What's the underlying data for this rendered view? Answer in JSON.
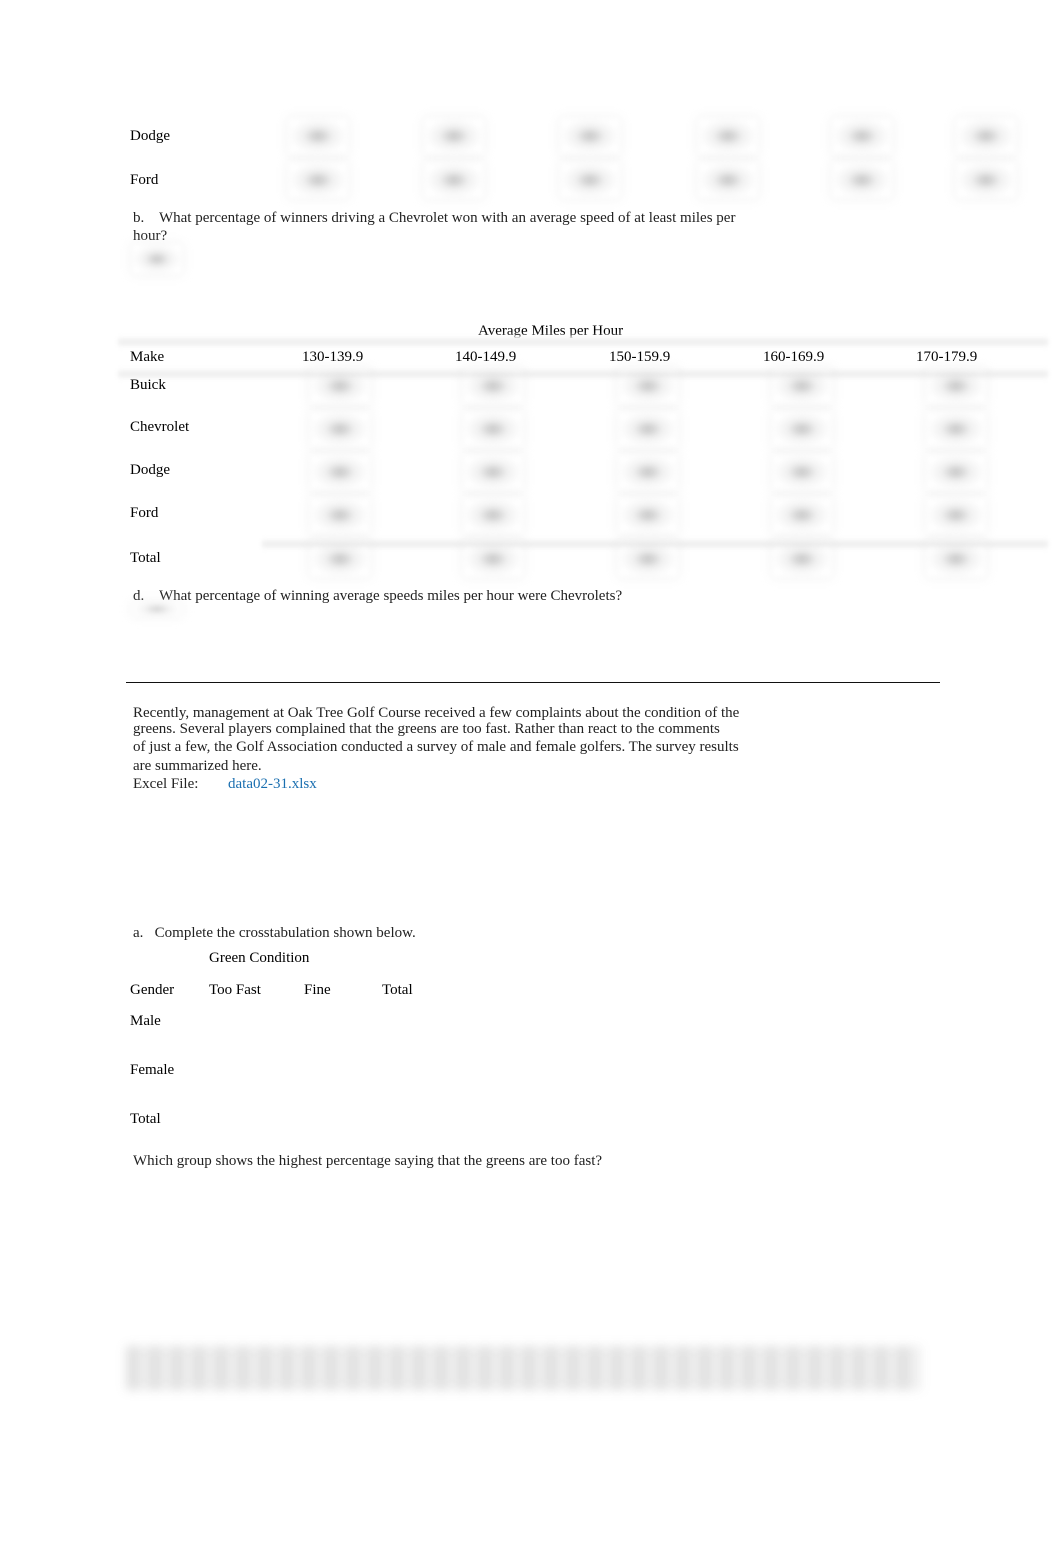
{
  "table1_partial": {
    "rows": [
      {
        "label": "Dodge"
      },
      {
        "label": "Ford"
      }
    ]
  },
  "question_b": {
    "marker": "b.",
    "text_line1": "What percentage of winners driving a Chevrolet won with an average speed of at least miles per",
    "text_line2": "hour?"
  },
  "table2": {
    "title": "Average Miles per Hour",
    "header": {
      "make": "Make",
      "columns": [
        "130-139.9",
        "140-149.9",
        "150-159.9",
        "160-169.9",
        "170-179.9"
      ]
    },
    "rows": [
      {
        "label": "Buick"
      },
      {
        "label": "Chevrolet"
      },
      {
        "label": "Dodge"
      },
      {
        "label": "Ford"
      },
      {
        "label": "Total"
      }
    ]
  },
  "question_d": {
    "marker": "d.",
    "text": "What percentage of winning average speeds miles per hour were Chevrolets?"
  },
  "golf": {
    "para_lines": [
      "Recently, management at Oak Tree Golf Course received a few complaints about the condition of the",
      "greens. Several players complained that the greens are too fast. Rather than react to the comments",
      "of just a few, the Golf Association conducted a survey of male and female golfers. The survey results",
      "are summarized here."
    ],
    "excel_label": "Excel File:",
    "excel_link": "data02-31.xlsx",
    "link_color": "#1a6fb0",
    "question_a": {
      "marker": "a.",
      "text": "Complete the crosstabulation shown below."
    },
    "crosstab": {
      "title": "Green Condition",
      "header": [
        "Gender",
        "Too Fast",
        "Fine",
        "Total"
      ],
      "rows": [
        "Male",
        "Female",
        "Total"
      ]
    },
    "question_final": "Which group shows the highest percentage saying that the greens are too fast?"
  }
}
